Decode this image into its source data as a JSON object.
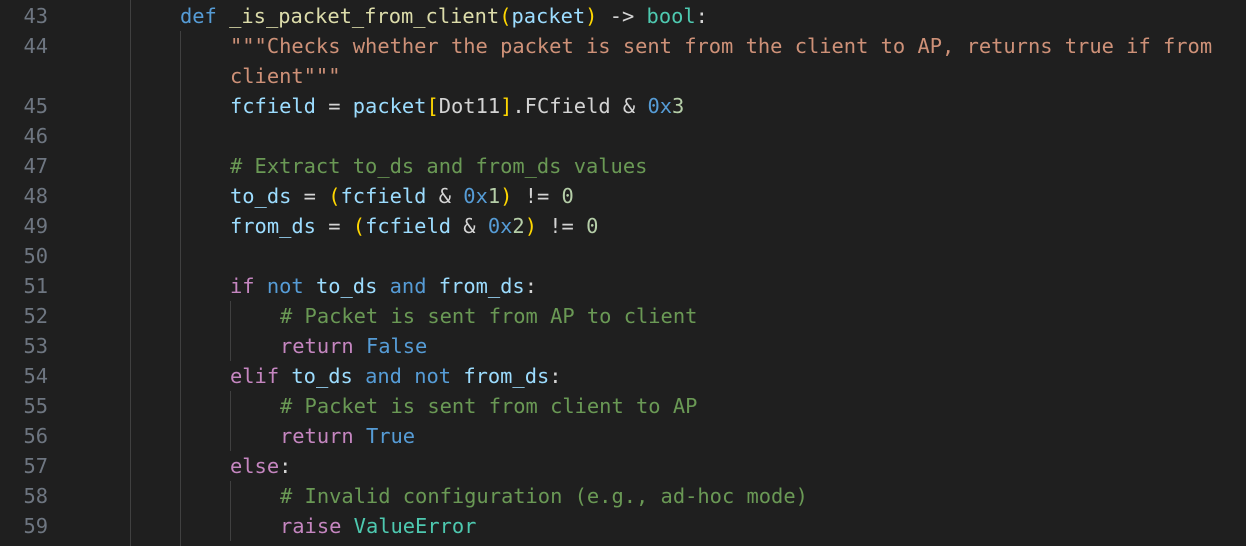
{
  "editor": {
    "line_numbers": [
      "43",
      "44",
      "",
      "45",
      "46",
      "47",
      "48",
      "49",
      "50",
      "51",
      "52",
      "53",
      "54",
      "55",
      "56",
      "57",
      "58",
      "59"
    ],
    "lines": [
      {
        "indent": 0,
        "tokens": [
          {
            "t": "def",
            "c": "kw"
          },
          {
            "t": " ",
            "c": "plain"
          },
          {
            "t": "_is_packet_from_client",
            "c": "fn"
          },
          {
            "t": "(",
            "c": "br1"
          },
          {
            "t": "packet",
            "c": "param"
          },
          {
            "t": ")",
            "c": "br1"
          },
          {
            "t": " -> ",
            "c": "plain"
          },
          {
            "t": "bool",
            "c": "type"
          },
          {
            "t": ":",
            "c": "plain"
          }
        ]
      },
      {
        "indent": 1,
        "tokens": [
          {
            "t": "\"\"\"Checks whether the packet is sent from the client to AP, returns true if from",
            "c": "str"
          }
        ]
      },
      {
        "indent": 1,
        "tokens": [
          {
            "t": "client\"\"\"",
            "c": "str"
          }
        ]
      },
      {
        "indent": 1,
        "tokens": [
          {
            "t": "fcfield",
            "c": "param"
          },
          {
            "t": " = ",
            "c": "plain"
          },
          {
            "t": "packet",
            "c": "param"
          },
          {
            "t": "[",
            "c": "br1"
          },
          {
            "t": "Dot11",
            "c": "plain"
          },
          {
            "t": "]",
            "c": "br1"
          },
          {
            "t": ".FCfield & ",
            "c": "plain"
          },
          {
            "t": "0x",
            "c": "kw"
          },
          {
            "t": "3",
            "c": "num"
          }
        ]
      },
      {
        "indent": 1,
        "tokens": []
      },
      {
        "indent": 1,
        "tokens": [
          {
            "t": "# Extract to_ds and from_ds values",
            "c": "cmt"
          }
        ]
      },
      {
        "indent": 1,
        "tokens": [
          {
            "t": "to_ds",
            "c": "param"
          },
          {
            "t": " = ",
            "c": "plain"
          },
          {
            "t": "(",
            "c": "br1"
          },
          {
            "t": "fcfield",
            "c": "param"
          },
          {
            "t": " & ",
            "c": "plain"
          },
          {
            "t": "0x",
            "c": "kw"
          },
          {
            "t": "1",
            "c": "num"
          },
          {
            "t": ")",
            "c": "br1"
          },
          {
            "t": " != ",
            "c": "plain"
          },
          {
            "t": "0",
            "c": "num"
          }
        ]
      },
      {
        "indent": 1,
        "tokens": [
          {
            "t": "from_ds",
            "c": "param"
          },
          {
            "t": " = ",
            "c": "plain"
          },
          {
            "t": "(",
            "c": "br1"
          },
          {
            "t": "fcfield",
            "c": "param"
          },
          {
            "t": " & ",
            "c": "plain"
          },
          {
            "t": "0x",
            "c": "kw"
          },
          {
            "t": "2",
            "c": "num"
          },
          {
            "t": ")",
            "c": "br1"
          },
          {
            "t": " != ",
            "c": "plain"
          },
          {
            "t": "0",
            "c": "num"
          }
        ]
      },
      {
        "indent": 1,
        "tokens": []
      },
      {
        "indent": 1,
        "tokens": [
          {
            "t": "if",
            "c": "ctrl"
          },
          {
            "t": " ",
            "c": "plain"
          },
          {
            "t": "not",
            "c": "kw"
          },
          {
            "t": " ",
            "c": "plain"
          },
          {
            "t": "to_ds",
            "c": "param"
          },
          {
            "t": " ",
            "c": "plain"
          },
          {
            "t": "and",
            "c": "kw"
          },
          {
            "t": " ",
            "c": "plain"
          },
          {
            "t": "from_ds",
            "c": "param"
          },
          {
            "t": ":",
            "c": "plain"
          }
        ]
      },
      {
        "indent": 2,
        "tokens": [
          {
            "t": "# Packet is sent from AP to client",
            "c": "cmt"
          }
        ]
      },
      {
        "indent": 2,
        "tokens": [
          {
            "t": "return",
            "c": "ctrl"
          },
          {
            "t": " ",
            "c": "plain"
          },
          {
            "t": "False",
            "c": "kw"
          }
        ]
      },
      {
        "indent": 1,
        "tokens": [
          {
            "t": "elif",
            "c": "ctrl"
          },
          {
            "t": " ",
            "c": "plain"
          },
          {
            "t": "to_ds",
            "c": "param"
          },
          {
            "t": " ",
            "c": "plain"
          },
          {
            "t": "and",
            "c": "kw"
          },
          {
            "t": " ",
            "c": "plain"
          },
          {
            "t": "not",
            "c": "kw"
          },
          {
            "t": " ",
            "c": "plain"
          },
          {
            "t": "from_ds",
            "c": "param"
          },
          {
            "t": ":",
            "c": "plain"
          }
        ]
      },
      {
        "indent": 2,
        "tokens": [
          {
            "t": "# Packet is sent from client to AP",
            "c": "cmt"
          }
        ]
      },
      {
        "indent": 2,
        "tokens": [
          {
            "t": "return",
            "c": "ctrl"
          },
          {
            "t": " ",
            "c": "plain"
          },
          {
            "t": "True",
            "c": "kw"
          }
        ]
      },
      {
        "indent": 1,
        "tokens": [
          {
            "t": "else",
            "c": "ctrl"
          },
          {
            "t": ":",
            "c": "plain"
          }
        ]
      },
      {
        "indent": 2,
        "tokens": [
          {
            "t": "# Invalid configuration (e.g., ad-hoc mode)",
            "c": "cmt"
          }
        ]
      },
      {
        "indent": 2,
        "tokens": [
          {
            "t": "raise",
            "c": "ctrl"
          },
          {
            "t": " ",
            "c": "plain"
          },
          {
            "t": "ValueError",
            "c": "type"
          }
        ]
      }
    ]
  }
}
